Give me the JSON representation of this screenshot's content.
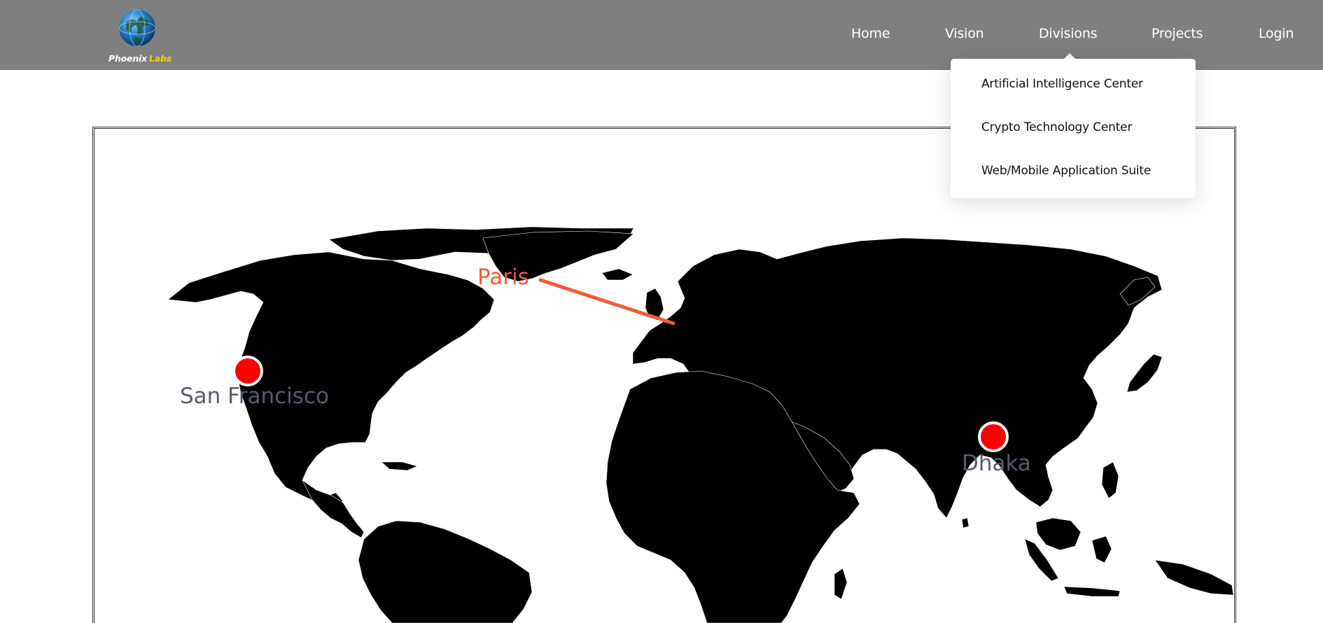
{
  "header": {
    "logo": {
      "name_part1": "Phoenix",
      "name_part2": "Labs",
      "icon": "globe-icon",
      "accent_color": "#f2d400"
    },
    "background_color": "#7f7f7f",
    "nav": [
      {
        "label": "Home"
      },
      {
        "label": "Vision"
      },
      {
        "label": "Divisions"
      },
      {
        "label": "Projects"
      },
      {
        "label": "Login"
      }
    ]
  },
  "divisions_dropdown": {
    "open": true,
    "items": [
      {
        "label": "Artificial Intelligence Center"
      },
      {
        "label": "Crypto Technology Center"
      },
      {
        "label": "Web/Mobile Application Suite"
      }
    ]
  },
  "map": {
    "land_color": "#000000",
    "marker_color": "#ff0000",
    "route_color": "#f25a3a",
    "cities": [
      {
        "name": "San Francisco",
        "marker": true,
        "label_color": "#5a5a6e"
      },
      {
        "name": "Paris",
        "marker": false,
        "label_color": "#f25a3a"
      },
      {
        "name": "Dhaka",
        "marker": true,
        "label_color": "#5a5a6e"
      }
    ]
  }
}
